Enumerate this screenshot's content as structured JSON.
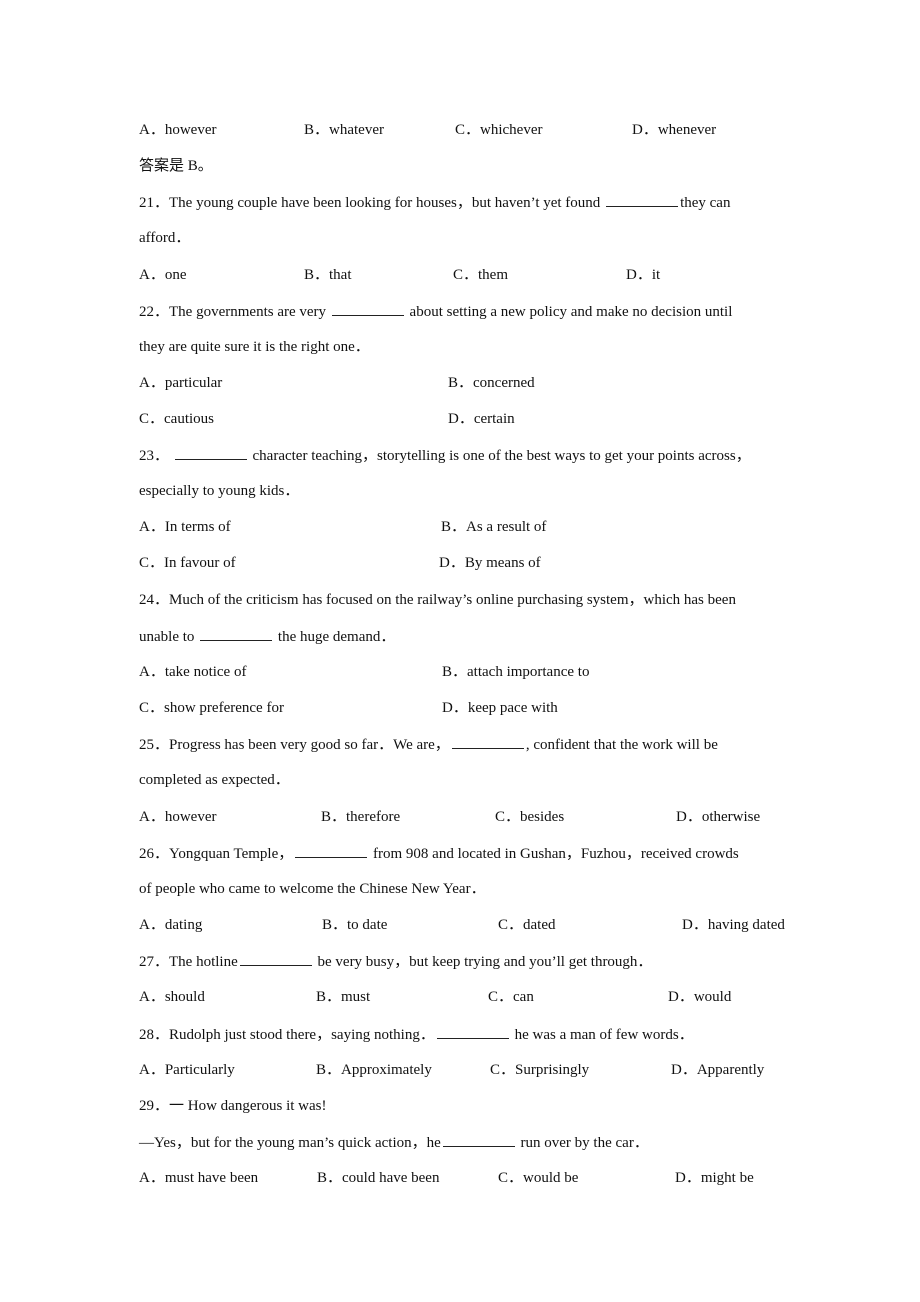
{
  "document": {
    "prev_question_options": [
      "A．however",
      "B．whatever",
      "C．whichever",
      "D．whenever"
    ],
    "answer_note": "答案是 B。",
    "questions": [
      {
        "number": "21．",
        "stem_parts": [
          "The young couple have been looking for houses，but haven’t yet found ",
          "they can"
        ],
        "stem_line2": "afford．",
        "options": [
          "A．one",
          "B．that",
          "C．them",
          "D．it"
        ]
      },
      {
        "number": "22．",
        "stem_parts": [
          "The governments are very ",
          " about setting a new policy and make no decision until"
        ],
        "stem_line2": "they are quite sure it is the right one．",
        "options": [
          "A．particular",
          "B．concerned",
          "C．cautious",
          "D．certain"
        ]
      },
      {
        "number": "23．",
        "stem_parts": [
          " ",
          " character teaching，storytelling is one of the best ways to get your points across，"
        ],
        "stem_line2": "especially to young kids．",
        "options": [
          "A．In terms of",
          "B．As a result of",
          "C．In favour of",
          "D．By means of"
        ]
      },
      {
        "number": "24．",
        "stem_parts": [
          "Much of the criticism has focused on the railway’s online purchasing system，which has been"
        ],
        "stem_line2_parts": [
          "unable to ",
          " the huge demand．"
        ],
        "options": [
          "A．take notice of",
          "B．attach importance to",
          "C．show preference for",
          "D．keep pace with"
        ]
      },
      {
        "number": "25．",
        "stem_parts": [
          "Progress has been very good so far．We are，",
          ", confident that the work will be"
        ],
        "stem_line2": "completed as expected．",
        "options": [
          "A．however",
          "B．therefore",
          "C．besides",
          "D．otherwise"
        ]
      },
      {
        "number": "26．",
        "stem_parts": [
          "Yongquan Temple，",
          " from 908 and located in Gushan，Fuzhou，received crowds"
        ],
        "stem_line2": "of people who came to welcome the Chinese New Year．",
        "options": [
          "A．dating",
          "B．to date",
          "C．dated",
          "D．having dated"
        ]
      },
      {
        "number": "27．",
        "stem_parts": [
          "The hotline",
          " be very busy，but keep trying and you’ll get through．"
        ],
        "options": [
          "A．should",
          "B．must",
          "C．can",
          "D．would"
        ]
      },
      {
        "number": "28．",
        "stem_parts": [
          "Rudolph just stood there，saying nothing．",
          " he was a man of few words．"
        ],
        "options": [
          "A．Particularly",
          "B．Approximately",
          "C．Surprisingly",
          "D．Apparently"
        ]
      },
      {
        "number": "29．",
        "stem_parts": [
          "一 How dangerous it was!"
        ],
        "stem_line2_parts": [
          "—Yes，but for the young man’s quick action，he",
          " run over by the car．"
        ],
        "options": [
          "A．must have been",
          "B．could have been",
          "C．would be",
          "D．might be"
        ]
      }
    ]
  }
}
